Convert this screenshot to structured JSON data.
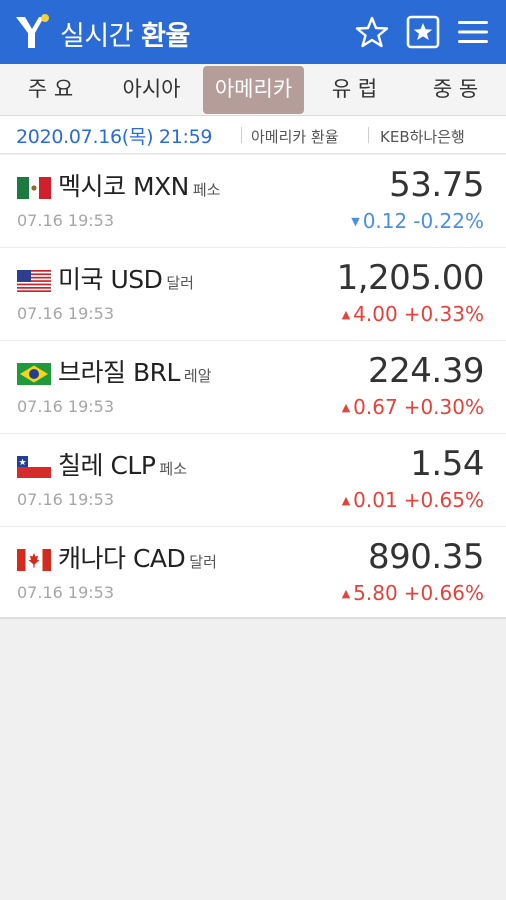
{
  "header": {
    "title_light": "실시간",
    "title_bold": "환율",
    "accent_color": "#2a6bd6"
  },
  "tabs": [
    {
      "label": "주 요",
      "active": false
    },
    {
      "label": "아시아",
      "active": false
    },
    {
      "label": "아메리카",
      "active": true
    },
    {
      "label": "유 럽",
      "active": false
    },
    {
      "label": "중 동",
      "active": false
    }
  ],
  "info": {
    "datetime": "2020.07.16(목) 21:59",
    "category": "아메리카 환율",
    "bank": "KEB하나은행"
  },
  "currencies": [
    {
      "flag": "mexico-flag",
      "name": "멕시코 MXN",
      "unit": "페소",
      "time": "07.16 19:53",
      "price": "53.75",
      "direction": "down",
      "change": "0.12",
      "percent": "-0.22%"
    },
    {
      "flag": "usa-flag",
      "name": "미국 USD",
      "unit": "달러",
      "time": "07.16 19:53",
      "price": "1,205.00",
      "direction": "up",
      "change": "4.00",
      "percent": "+0.33%"
    },
    {
      "flag": "brazil-flag",
      "name": "브라질 BRL",
      "unit": "레알",
      "time": "07.16 19:53",
      "price": "224.39",
      "direction": "up",
      "change": "0.67",
      "percent": "+0.30%"
    },
    {
      "flag": "chile-flag",
      "name": "칠레 CLP",
      "unit": "페소",
      "time": "07.16 19:53",
      "price": "1.54",
      "direction": "up",
      "change": "0.01",
      "percent": "+0.65%"
    },
    {
      "flag": "canada-flag",
      "name": "캐나다 CAD",
      "unit": "달러",
      "time": "07.16 19:53",
      "price": "890.35",
      "direction": "up",
      "change": "5.80",
      "percent": "+0.66%"
    }
  ],
  "colors": {
    "up": "#e8403a",
    "down": "#4a90e2",
    "active_tab": "#b59d9a"
  }
}
